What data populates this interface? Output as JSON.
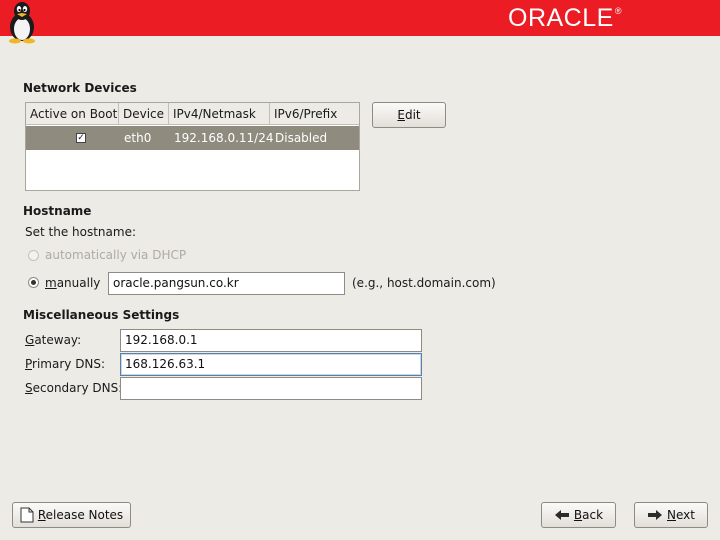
{
  "header": {
    "brand": "ORACLE",
    "brand_mark": "®",
    "tux_icon": "tux-penguin-icon",
    "color": "#ec1c24"
  },
  "network_devices": {
    "title": "Network Devices",
    "columns": [
      "Active on Boot",
      "Device",
      "IPv4/Netmask",
      "IPv6/Prefix"
    ],
    "rows": [
      {
        "active_on_boot": true,
        "device": "eth0",
        "ipv4": "192.168.0.11/24",
        "ipv6": "Disabled"
      }
    ],
    "selected_row_color": "#8f8b7e",
    "edit_button": {
      "mnemonic": "E",
      "rest": "dit"
    }
  },
  "hostname": {
    "title": "Hostname",
    "prompt": "Set the hostname:",
    "auto_option": "automatically via DHCP",
    "manual_option": {
      "mnemonic": "m",
      "rest": "anually"
    },
    "value": "oracle.pangsun.co.kr",
    "hint": "(e.g., host.domain.com)"
  },
  "misc": {
    "title": "Miscellaneous Settings",
    "gateway": {
      "mnemonic": "G",
      "rest": "ateway:",
      "value": "192.168.0.1"
    },
    "primary_dns": {
      "mnemonic": "P",
      "rest": "rimary DNS:",
      "value": "168.126.63.1"
    },
    "secondary_dns": {
      "mnemonic": "S",
      "rest": "econdary DNS:",
      "value": ""
    }
  },
  "footer": {
    "release_notes": {
      "mnemonic": "R",
      "rest": "elease Notes",
      "icon": "document-icon"
    },
    "back": {
      "mnemonic": "B",
      "rest": "ack",
      "icon": "back-arrow-icon"
    },
    "next": {
      "mnemonic": "N",
      "rest": "ext",
      "icon": "next-arrow-icon"
    }
  }
}
